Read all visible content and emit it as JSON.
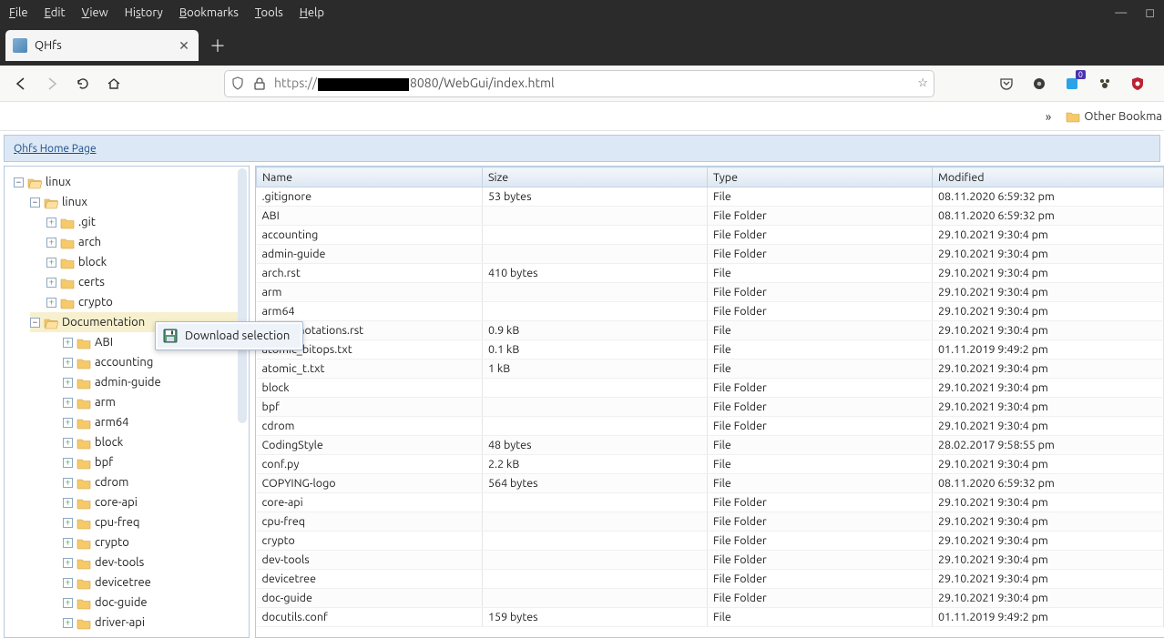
{
  "menu": {
    "file": "File",
    "edit": "Edit",
    "view": "View",
    "history": "History",
    "bookmarks": "Bookmarks",
    "tools": "Tools",
    "help": "Help"
  },
  "tab": {
    "title": "QHfs"
  },
  "url": {
    "scheme": "https://",
    "after": "8080/WebGui/index.html"
  },
  "bookbar": {
    "other": "Other Bookma"
  },
  "breadcrumb": {
    "home": "Qhfs Home Page"
  },
  "contextmenu": {
    "download": "Download selection"
  },
  "tree": {
    "linux": "linux",
    "linux2": "linux",
    "git": ".git",
    "arch": "arch",
    "block": "block",
    "certs": "certs",
    "crypto": "crypto",
    "documentation": "Documentation",
    "abi": "ABI",
    "accounting": "accounting",
    "adminguide": "admin-guide",
    "arm": "arm",
    "arm64": "arm64",
    "block2": "block",
    "bpf": "bpf",
    "cdrom": "cdrom",
    "coreapi": "core-api",
    "cpufreq": "cpu-freq",
    "crypto2": "crypto",
    "devtools": "dev-tools",
    "devicetree": "devicetree",
    "docguide": "doc-guide",
    "driverapi": "driver-api"
  },
  "columns": {
    "name": "Name",
    "size": "Size",
    "type": "Type",
    "modified": "Modified"
  },
  "types": {
    "file": "File",
    "folder": "File Folder"
  },
  "rows": [
    {
      "name": ".gitignore",
      "size": "53 bytes",
      "type": "file",
      "mod": "08.11.2020 6:59:32 pm"
    },
    {
      "name": "ABI",
      "size": "",
      "type": "folder",
      "mod": "08.11.2020 6:59:32 pm"
    },
    {
      "name": "accounting",
      "size": "",
      "type": "folder",
      "mod": "29.10.2021 9:30:4 pm"
    },
    {
      "name": "admin-guide",
      "size": "",
      "type": "folder",
      "mod": "29.10.2021 9:30:4 pm"
    },
    {
      "name": "arch.rst",
      "size": "410 bytes",
      "type": "file",
      "mod": "29.10.2021 9:30:4 pm"
    },
    {
      "name": "arm",
      "size": "",
      "type": "folder",
      "mod": "29.10.2021 9:30:4 pm"
    },
    {
      "name": "arm64",
      "size": "",
      "type": "folder",
      "mod": "29.10.2021 9:30:4 pm"
    },
    {
      "name": "asm-annotations.rst",
      "size": "0.9 kB",
      "type": "file",
      "mod": "29.10.2021 9:30:4 pm"
    },
    {
      "name": "atomic_bitops.txt",
      "size": "0.1 kB",
      "type": "file",
      "mod": "01.11.2019 9:49:2 pm"
    },
    {
      "name": "atomic_t.txt",
      "size": "1 kB",
      "type": "file",
      "mod": "29.10.2021 9:30:4 pm"
    },
    {
      "name": "block",
      "size": "",
      "type": "folder",
      "mod": "29.10.2021 9:30:4 pm"
    },
    {
      "name": "bpf",
      "size": "",
      "type": "folder",
      "mod": "29.10.2021 9:30:4 pm"
    },
    {
      "name": "cdrom",
      "size": "",
      "type": "folder",
      "mod": "29.10.2021 9:30:4 pm"
    },
    {
      "name": "CodingStyle",
      "size": "48 bytes",
      "type": "file",
      "mod": "28.02.2017 9:58:55 pm"
    },
    {
      "name": "conf.py",
      "size": "2.2 kB",
      "type": "file",
      "mod": "29.10.2021 9:30:4 pm"
    },
    {
      "name": "COPYING-logo",
      "size": "564 bytes",
      "type": "file",
      "mod": "08.11.2020 6:59:32 pm"
    },
    {
      "name": "core-api",
      "size": "",
      "type": "folder",
      "mod": "29.10.2021 9:30:4 pm"
    },
    {
      "name": "cpu-freq",
      "size": "",
      "type": "folder",
      "mod": "29.10.2021 9:30:4 pm"
    },
    {
      "name": "crypto",
      "size": "",
      "type": "folder",
      "mod": "29.10.2021 9:30:4 pm"
    },
    {
      "name": "dev-tools",
      "size": "",
      "type": "folder",
      "mod": "29.10.2021 9:30:4 pm"
    },
    {
      "name": "devicetree",
      "size": "",
      "type": "folder",
      "mod": "29.10.2021 9:30:4 pm"
    },
    {
      "name": "doc-guide",
      "size": "",
      "type": "folder",
      "mod": "29.10.2021 9:30:4 pm"
    },
    {
      "name": "docutils.conf",
      "size": "159 bytes",
      "type": "file",
      "mod": "01.11.2019 9:49:2 pm"
    }
  ]
}
